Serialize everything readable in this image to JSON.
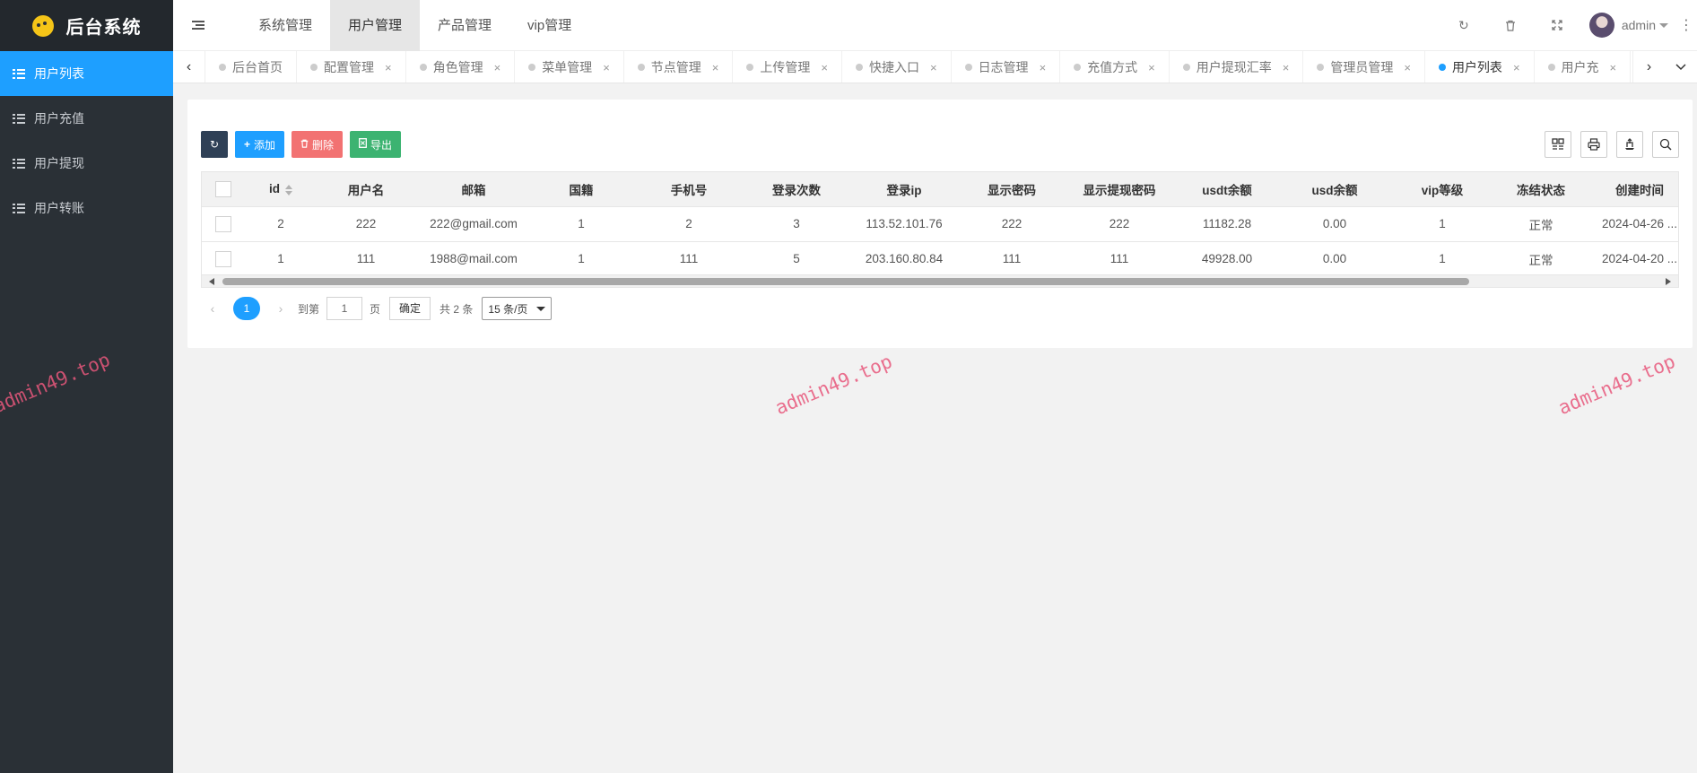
{
  "app": {
    "title": "后台系统"
  },
  "sidebar": {
    "items": [
      {
        "label": "用户列表",
        "active": true
      },
      {
        "label": "用户充值",
        "active": false
      },
      {
        "label": "用户提现",
        "active": false
      },
      {
        "label": "用户转账",
        "active": false
      }
    ]
  },
  "header": {
    "nav": [
      {
        "label": "系统管理",
        "active": false
      },
      {
        "label": "用户管理",
        "active": true
      },
      {
        "label": "产品管理",
        "active": false
      },
      {
        "label": "vip管理",
        "active": false
      }
    ],
    "user": "admin"
  },
  "tabs": [
    {
      "label": "后台首页",
      "closable": false
    },
    {
      "label": "配置管理",
      "closable": true
    },
    {
      "label": "角色管理",
      "closable": true
    },
    {
      "label": "菜单管理",
      "closable": true
    },
    {
      "label": "节点管理",
      "closable": true
    },
    {
      "label": "上传管理",
      "closable": true
    },
    {
      "label": "快捷入口",
      "closable": true
    },
    {
      "label": "日志管理",
      "closable": true
    },
    {
      "label": "充值方式",
      "closable": true
    },
    {
      "label": "用户提现汇率",
      "closable": true
    },
    {
      "label": "管理员管理",
      "closable": true
    },
    {
      "label": "用户列表",
      "closable": true,
      "active": true
    },
    {
      "label": "用户充",
      "closable": true
    }
  ],
  "toolbar": {
    "add": "添加",
    "delete": "删除",
    "export": "导出"
  },
  "table": {
    "columns": [
      "id",
      "用户名",
      "邮箱",
      "国籍",
      "手机号",
      "登录次数",
      "登录ip",
      "显示密码",
      "显示提现密码",
      "usdt余额",
      "usd余额",
      "vip等级",
      "冻结状态",
      "创建时间"
    ],
    "rows": [
      [
        "2",
        "222",
        "222@gmail.com",
        "1",
        "2",
        "3",
        "113.52.101.76",
        "222",
        "222",
        "11182.28",
        "0.00",
        "1",
        "正常",
        "2024-04-26 ..."
      ],
      [
        "1",
        "111",
        "1988@mail.com",
        "1",
        "111",
        "5",
        "203.160.80.84",
        "111",
        "111",
        "49928.00",
        "0.00",
        "1",
        "正常",
        "2024-04-20 ..."
      ]
    ]
  },
  "pager": {
    "current": "1",
    "goto_prefix": "到第",
    "goto_value": "1",
    "goto_suffix": "页",
    "confirm": "确定",
    "total": "共 2 条",
    "page_size": "15 条/页"
  },
  "watermark": "admin49.top"
}
